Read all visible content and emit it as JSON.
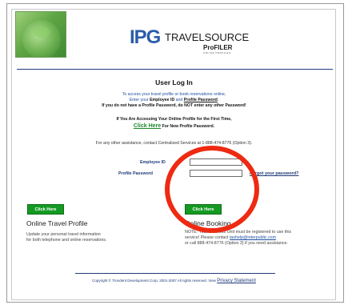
{
  "brand": {
    "logo_ipg": "IPG",
    "logo_name": "TRAVELSOURCE",
    "logo_product": "ProFILER",
    "logo_tagline": "ONLINE PROFILES"
  },
  "login": {
    "title": "User Log In",
    "intro_line1": "To access your travel profile or book reservations online,",
    "intro_line2_prefix": "Enter your ",
    "intro_line2_emp": "Employee ID",
    "intro_line2_mid": " and ",
    "intro_line2_pw": "Profile Password",
    "intro_line2_suffix": ".",
    "intro_line3": "If you do not have a Profile Password, do NOT enter any other Password!",
    "first_time_line1": "If You Are Accessing Your Online Profile for the First Time,",
    "first_time_click": "Click Here",
    "first_time_line2": "For New Profile Password.",
    "assistance": "For any other assistance, contact Centralized Services at 1-888-474-8776 (Option 3).",
    "employee_id_label": "Employee ID",
    "employee_id_value": "",
    "password_label": "Profile Password",
    "password_value": "",
    "forgot_link": "Forgot your password?"
  },
  "sections": {
    "left_button": "Click Here",
    "left_title": "Online Travel Profile",
    "left_body_1": "Update your personal travel information",
    "left_body_2": "for both telephone and online reservations.",
    "right_button": "Click Here",
    "right_title": "Online Booking",
    "right_body_1": "NOTE: Your Business Unit must be registered to use this",
    "right_body_2_prefix": "service! Please contact ",
    "right_body_2_link": "tashelp@interpublic.com",
    "right_body_3": "or call 888-474-8776 (Option 3) if you need assistance."
  },
  "footer": {
    "copyright": "Copyright © Trondent Development Corp. 2001-2007 All rights reserved. View ",
    "privacy_link": "Privacy Statement"
  },
  "colors": {
    "brand_blue": "#1f3a78",
    "button_green": "#149a22",
    "annotation_red": "#ee2a12"
  }
}
